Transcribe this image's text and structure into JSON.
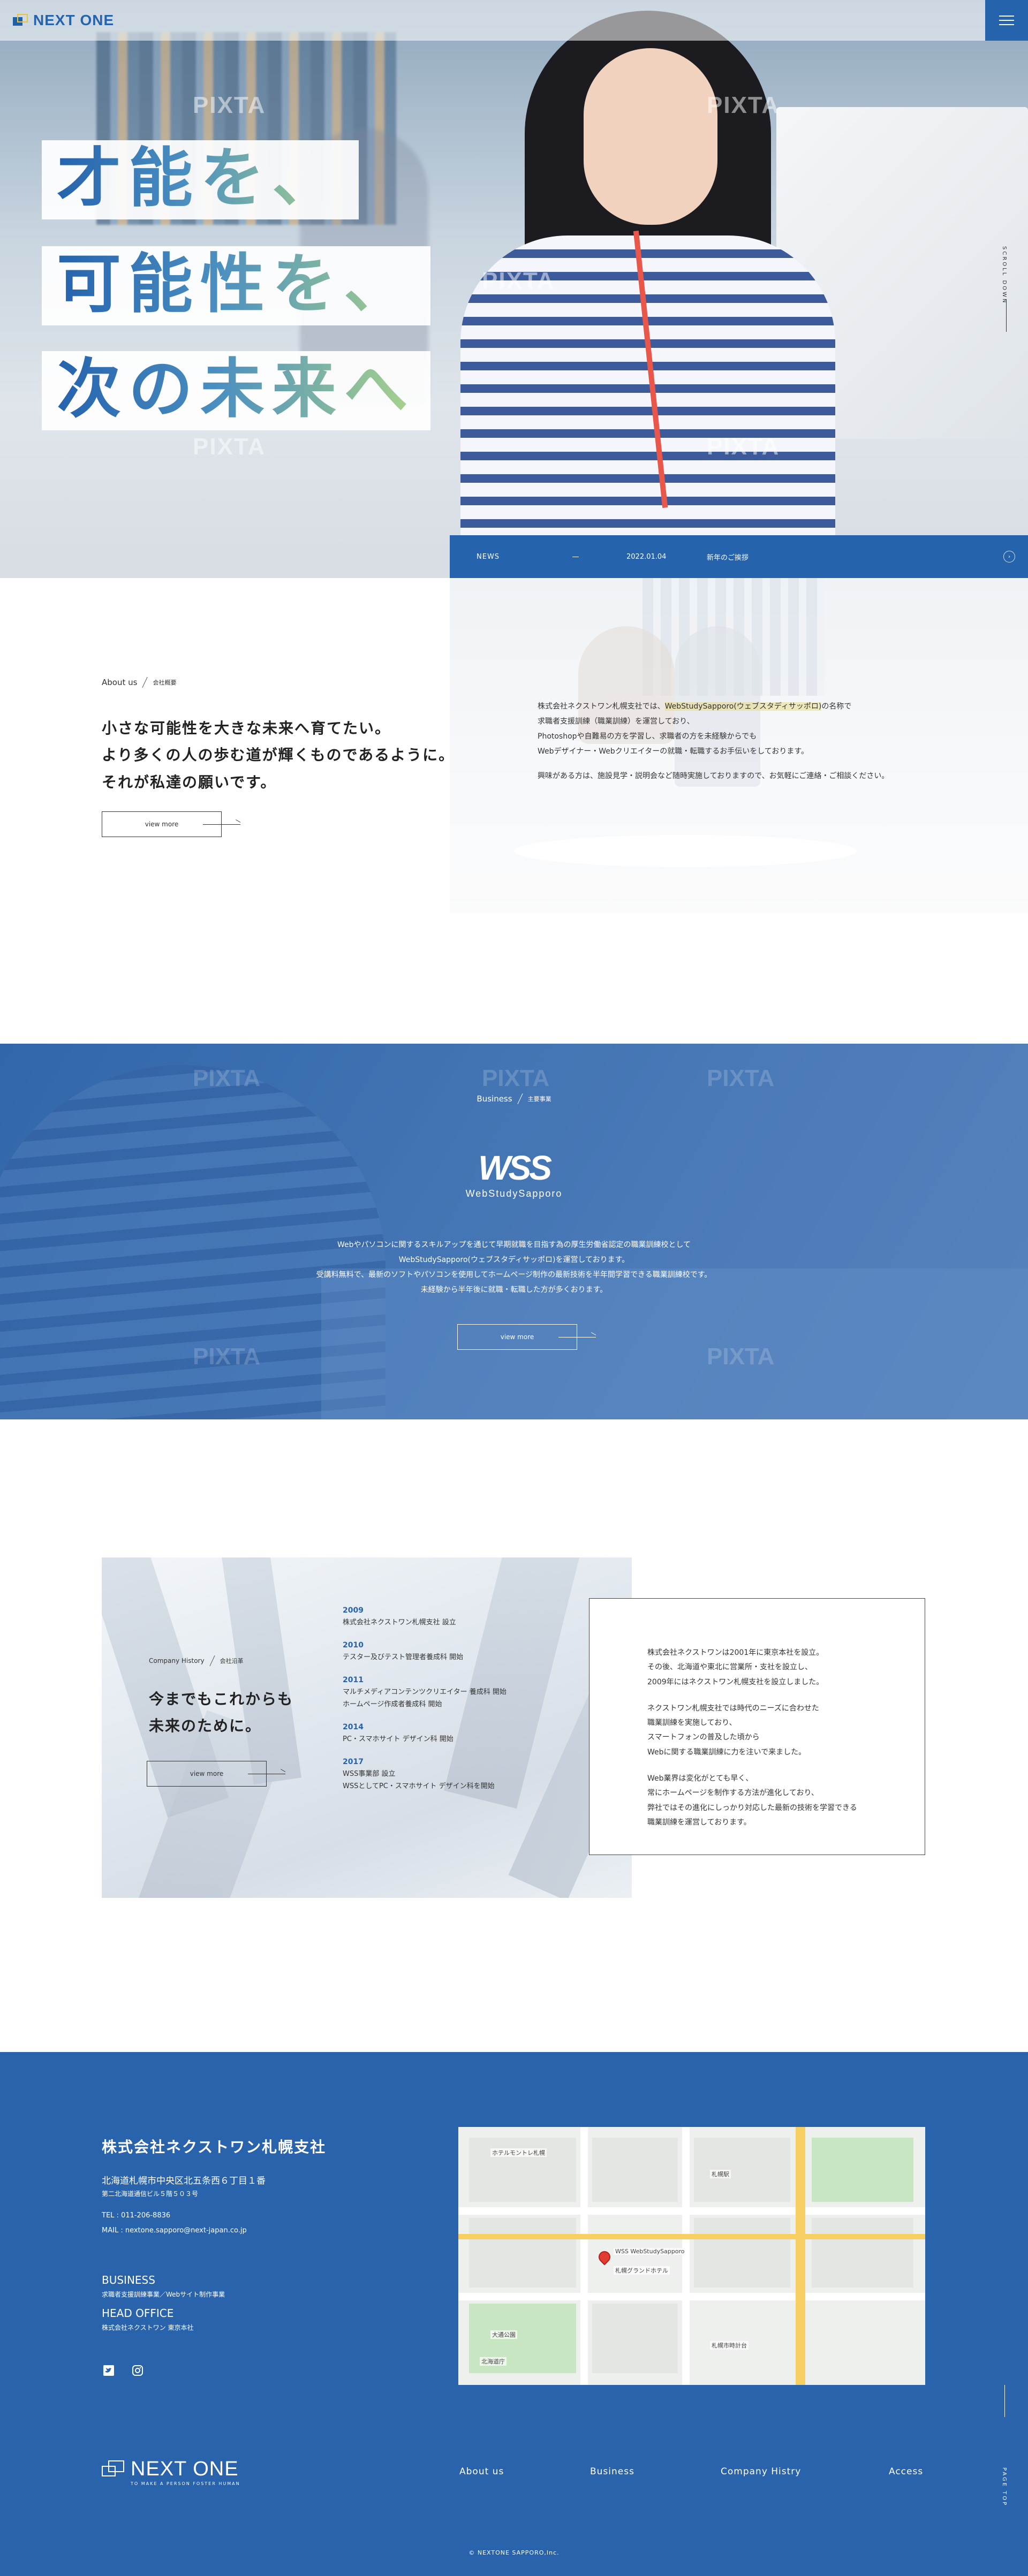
{
  "header": {
    "logo_text": "NEXT ONE",
    "menu_icon": "hamburger-icon"
  },
  "hero": {
    "catch_lines": [
      "才能を、",
      "可能性を、",
      "次の未来へ"
    ],
    "watermark": "PIXTA",
    "scroll_label": "SCROLL DOWN"
  },
  "news": {
    "label": "NEWS",
    "dash": "—",
    "date": "2022.01.04",
    "title": "新年のご挨拶",
    "arrow_icon": "circle-arrow-icon"
  },
  "about": {
    "label_en": "About us",
    "label_jp": "会社概要",
    "heading": [
      "小さな可能性を大きな未来へ育てたい。",
      "より多くの人の歩む道が輝くものであるように。",
      "それが私達の願いです。"
    ],
    "view_more": "view more",
    "text": {
      "p1_before": "株式会社ネクストワン札幌支社では、",
      "p1_highlight": "WebStudySapporo(ウェブスタディサッポロ)",
      "p1_after": "の名称で",
      "p1_lines": [
        "求職者支援訓練（職業訓練）を運営しており、",
        "Photoshopや自難易の方を学習し、求職者の方を未経験からでも",
        "Webデザイナー・Webクリエイターの就職・転職するお手伝いをしております。"
      ],
      "p2": "興味がある方は、施設見学・説明会など随時実施しておりますので、お気軽にご連絡・ご相談ください。"
    }
  },
  "business": {
    "label_en": "Business",
    "label_jp": "主要事業",
    "logo_mark": "WSS",
    "logo_sub": "WebStudySapporo",
    "text": [
      "Webやパソコンに関するスキルアップを通じて早期就職を目指す為の厚生労働省認定の職業訓練校として",
      "WebStudySapporo(ウェブスタディサッポロ)を運営しております。",
      "受講料無料で、最新のソフトやパソコンを使用してホームページ制作の最新技術を半年間学習できる職業訓練校です。",
      "未経験から半年後に就職・転職した方が多くおります。"
    ],
    "view_more": "view more",
    "watermark": "PIXTA"
  },
  "history": {
    "label_en": "Company History",
    "label_jp": "会社沿革",
    "heading": [
      "今までもこれからも",
      "未来のために。"
    ],
    "view_more": "view more",
    "timeline": [
      {
        "year": "2009",
        "events": [
          "株式会社ネクストワン札幌支社 設立"
        ]
      },
      {
        "year": "2010",
        "events": [
          "テスター及びテスト管理者養成科 開始"
        ]
      },
      {
        "year": "2011",
        "events": [
          "マルチメディアコンテンツクリエイター 養成科 開始",
          "ホームページ作成者養成科 開始"
        ]
      },
      {
        "year": "2014",
        "events": [
          "PC・スマホサイト デザイン科 開始"
        ]
      },
      {
        "year": "2017",
        "events": [
          "WSS事業部 設立",
          "WSSとしてPC・スマホサイト デザイン科を開始"
        ]
      }
    ],
    "box_paragraphs": [
      [
        "株式会社ネクストワンは2001年に東京本社を設立。",
        "その後、北海道や東北に営業所・支社を設立し、",
        "2009年にはネクストワン札幌支社を設立しました。"
      ],
      [
        "ネクストワン札幌支社では時代のニーズに合わせた",
        "職業訓練を実施しており、",
        "スマートフォンの普及した頃から",
        "Webに関する職業訓練に力を注いで来ました。"
      ],
      [
        "Web業界は変化がとても早く、",
        "常にホームページを制作する方法が進化しており、",
        "弊社ではその進化にしっかり対応した最新の技術を学習できる",
        "職業訓練を運営しております。"
      ]
    ]
  },
  "footer": {
    "company": "株式会社ネクストワン札幌支社",
    "address1": "北海道札幌市中央区北五条西６丁目１番",
    "address2": "第二北海道通信ビル５階５０３号",
    "tel": "TEL : 011-206-8836",
    "mail": "MAIL : nextone.sapporo@next-japan.co.jp",
    "business_heading": "BUSINESS",
    "business_text": "求職者支援訓練事業／Webサイト制作事業",
    "head_office_heading": "HEAD OFFICE",
    "head_office_text": "株式会社ネクストワン 東京本社",
    "social": [
      "twitter-icon",
      "instagram-icon"
    ],
    "map_labels": [
      "札幌駅",
      "WSS WebStudySapporo",
      "大通公園",
      "北海道庁",
      "札幌市時計台",
      "ホテルモントレ札幌",
      "札幌グランドホテル"
    ],
    "logo_text": "NEXT ONE",
    "logo_tagline": "TO MAKE A PERSON FOSTER HUMAN",
    "nav": [
      "About us",
      "Business",
      "Company Histry",
      "Access"
    ],
    "pagetop": "PAGE TOP",
    "copyright": "© NEXTONE SAPPORO,Inc."
  }
}
